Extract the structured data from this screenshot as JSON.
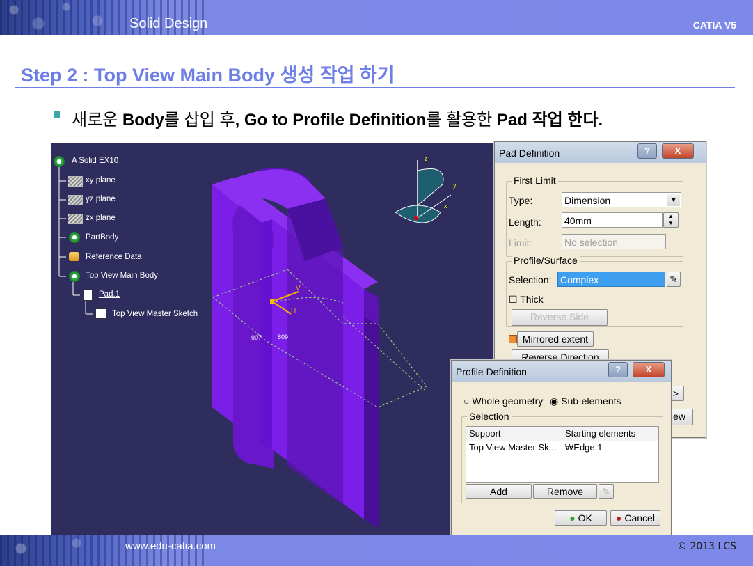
{
  "header": {
    "title": "Solid Design",
    "brand": "CATIA V5"
  },
  "footer": {
    "url": "www.edu-catia.com",
    "copyright": "© 2013 LCS"
  },
  "slide": {
    "step_title": "Step 2 : Top View Main Body 생성 작업 하기",
    "bullet_parts": [
      "새로운 ",
      "Body",
      "를 삽입 후",
      ", Go to Profile Definition",
      "를 활용한 ",
      "Pad",
      " 작업 한다."
    ]
  },
  "tree": {
    "root": "A Solid EX10",
    "items": [
      "xy plane",
      "yz plane",
      "zx plane",
      "PartBody",
      "Reference Data",
      "Top View Main Body",
      "Pad.1",
      "Top View Master Sketch"
    ]
  },
  "viewport": {
    "dim_left": "907",
    "dim_right": "809",
    "label_v": "V",
    "label_h": "H",
    "axis_z": "z",
    "axis_y": "y",
    "axis_x": "x"
  },
  "pad_dialog": {
    "title": "Pad Definition",
    "help_glyph": "?",
    "close_glyph": "X",
    "first_limit": "First Limit",
    "type_label": "Type:",
    "type_value": "Dimension",
    "length_label": "Length:",
    "length_value": "40mm",
    "limit_label": "Limit:",
    "limit_value": "No selection",
    "profile_surface": "Profile/Surface",
    "selection_label": "Selection:",
    "selection_value": "Complex",
    "thick_label": "Thick",
    "reverse_side": "Reverse Side",
    "mirrored_extent": "Mirrored extent",
    "reverse_direction": "Reverse Direction",
    "more_glyph": ">",
    "preview_partial": "ew"
  },
  "profile_dialog": {
    "title": "Profile Definition",
    "help_glyph": "?",
    "close_glyph": "X",
    "radio_whole": "Whole geometry",
    "radio_sub": "Sub-elements",
    "selection_group": "Selection",
    "columns": [
      "Support",
      "Starting elements"
    ],
    "rows": [
      [
        "Top View Master Sk...",
        "₩Edge.1"
      ]
    ],
    "add": "Add",
    "remove": "Remove",
    "ok": "OK",
    "cancel": "Cancel"
  },
  "colors": {
    "accent": "#6d7ee6",
    "viewport_bg": "#2e2d5e",
    "solid_face": "#7b1ee8",
    "solid_side": "#5a14b4"
  }
}
